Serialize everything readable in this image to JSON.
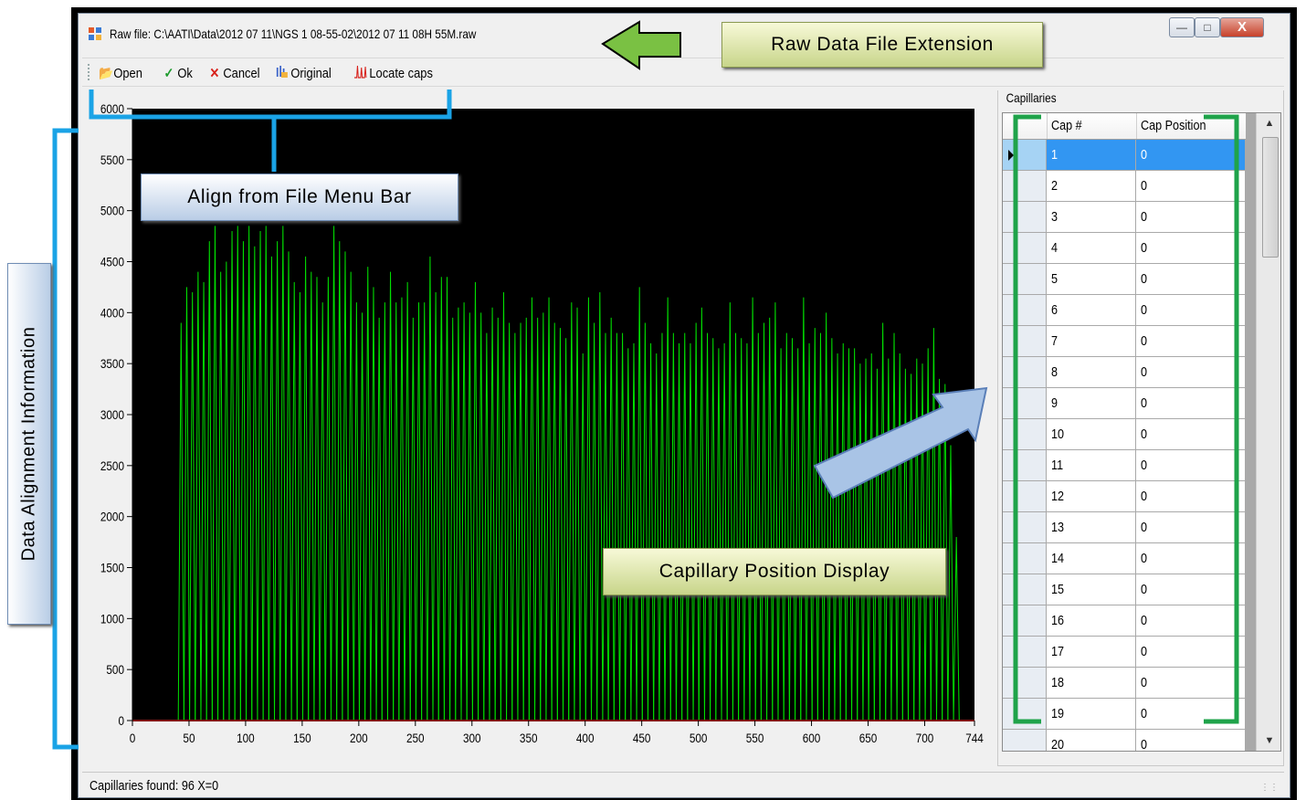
{
  "window": {
    "title": "Raw file: C:\\AATI\\Data\\2012 07 11\\NGS 1 08-55-02\\2012 07 11 08H 55M.raw",
    "minimize_glyph": "—",
    "maximize_glyph": "□",
    "close_glyph": "X"
  },
  "toolbar": {
    "open_label": "Open",
    "ok_label": "Ok",
    "cancel_label": "Cancel",
    "original_label": "Original",
    "locate_label": "Locate caps",
    "icons": {
      "open": "folder-open-icon",
      "ok": "check-icon",
      "cancel": "x-icon",
      "original": "bar-chart-icon",
      "locate": "peaks-icon"
    }
  },
  "chart_data": {
    "type": "line",
    "x_ticks": [
      "0",
      "50",
      "100",
      "150",
      "200",
      "250",
      "300",
      "350",
      "400",
      "450",
      "500",
      "550",
      "600",
      "650",
      "700",
      "744"
    ],
    "y_ticks": [
      "0",
      "500",
      "1000",
      "1500",
      "2000",
      "2500",
      "3000",
      "3500",
      "4000",
      "4500",
      "5000",
      "5500",
      "6000"
    ],
    "xlim": [
      0,
      744
    ],
    "ylim": [
      0,
      6000
    ],
    "background": "#000000",
    "line_color": "#00e000",
    "baseline_color": "#ff2020",
    "grid": false,
    "series": [
      {
        "peak_x": [
          43,
          48,
          53,
          58,
          63,
          68,
          73,
          78,
          83,
          88,
          93,
          98,
          103,
          108,
          113,
          118,
          123,
          128,
          133,
          138,
          143,
          148,
          153,
          158,
          163,
          168,
          173,
          178,
          183,
          188,
          193,
          198,
          203,
          208,
          213,
          218,
          223,
          228,
          233,
          238,
          243,
          248,
          253,
          258,
          263,
          268,
          273,
          278,
          283,
          288,
          293,
          298,
          303,
          308,
          313,
          318,
          323,
          328,
          333,
          338,
          343,
          348,
          353,
          358,
          363,
          368,
          373,
          378,
          383,
          388,
          393,
          398,
          403,
          408,
          413,
          418,
          423,
          428,
          433,
          438,
          443,
          448,
          453,
          458,
          463,
          468,
          473,
          478,
          483,
          488,
          493,
          498,
          503,
          508,
          513,
          518,
          523,
          528,
          533,
          538,
          543,
          548,
          553,
          558,
          563,
          568,
          573,
          578,
          583,
          588,
          593,
          598,
          603,
          608,
          613,
          618,
          623,
          628,
          633,
          638,
          643,
          648,
          653,
          658,
          663,
          668,
          673,
          678,
          683,
          688,
          693,
          698,
          703,
          708,
          713,
          718,
          723,
          728
        ],
        "peak_y": [
          3900,
          4250,
          4200,
          4400,
          4300,
          4700,
          4850,
          4400,
          4500,
          4800,
          4850,
          4700,
          4850,
          4650,
          4800,
          4850,
          4550,
          4700,
          4850,
          4600,
          4300,
          4200,
          4550,
          4400,
          4350,
          4100,
          4350,
          4850,
          4700,
          4600,
          4400,
          4100,
          4000,
          4450,
          4250,
          3950,
          4100,
          4400,
          4100,
          4150,
          4300,
          3950,
          4100,
          4100,
          4550,
          4200,
          4350,
          4350,
          3950,
          4050,
          4100,
          4000,
          4300,
          4000,
          3800,
          4050,
          3950,
          4200,
          3900,
          3800,
          3900,
          3950,
          4150,
          3950,
          4000,
          4150,
          3900,
          3850,
          3750,
          4100,
          4050,
          3600,
          4150,
          3900,
          4200,
          3800,
          3950,
          3800,
          3800,
          3650,
          3700,
          4250,
          3900,
          3700,
          3600,
          3800,
          4150,
          3800,
          3700,
          3800,
          3700,
          3900,
          4050,
          3800,
          3750,
          3650,
          3700,
          4100,
          3800,
          3750,
          3700,
          4150,
          3800,
          3900,
          3950,
          4100,
          3650,
          3800,
          3750,
          3650,
          4150,
          3700,
          3850,
          3800,
          4000,
          3750,
          3600,
          3700,
          3650,
          3650,
          3500,
          3550,
          3600,
          3450,
          3900,
          3550,
          3800,
          3600,
          3450,
          3400,
          3550,
          3500,
          3650,
          3850,
          3350,
          3300,
          2700,
          1800
        ]
      }
    ]
  },
  "capillaries": {
    "group_title": "Capillaries",
    "col_cap": "Cap #",
    "col_pos": "Cap Position",
    "rows": [
      {
        "cap": "1",
        "pos": "0"
      },
      {
        "cap": "2",
        "pos": "0"
      },
      {
        "cap": "3",
        "pos": "0"
      },
      {
        "cap": "4",
        "pos": "0"
      },
      {
        "cap": "5",
        "pos": "0"
      },
      {
        "cap": "6",
        "pos": "0"
      },
      {
        "cap": "7",
        "pos": "0"
      },
      {
        "cap": "8",
        "pos": "0"
      },
      {
        "cap": "9",
        "pos": "0"
      },
      {
        "cap": "10",
        "pos": "0"
      },
      {
        "cap": "11",
        "pos": "0"
      },
      {
        "cap": "12",
        "pos": "0"
      },
      {
        "cap": "13",
        "pos": "0"
      },
      {
        "cap": "14",
        "pos": "0"
      },
      {
        "cap": "15",
        "pos": "0"
      },
      {
        "cap": "16",
        "pos": "0"
      },
      {
        "cap": "17",
        "pos": "0"
      },
      {
        "cap": "18",
        "pos": "0"
      },
      {
        "cap": "19",
        "pos": "0"
      },
      {
        "cap": "20",
        "pos": "0"
      }
    ]
  },
  "status": {
    "text": "Capillaries found: 96  X=0"
  },
  "callouts": {
    "raw": "Raw Data File Extension",
    "align": "Align from File Menu Bar",
    "capdisplay": "Capillary Position Display",
    "data": "Data Alignment Information"
  },
  "colors": {
    "bracket_blue": "#1aa3e6",
    "bracket_green": "#1fa34a",
    "arrow_green": "#7ac143",
    "arrow_blue": "#a9c4e6"
  }
}
